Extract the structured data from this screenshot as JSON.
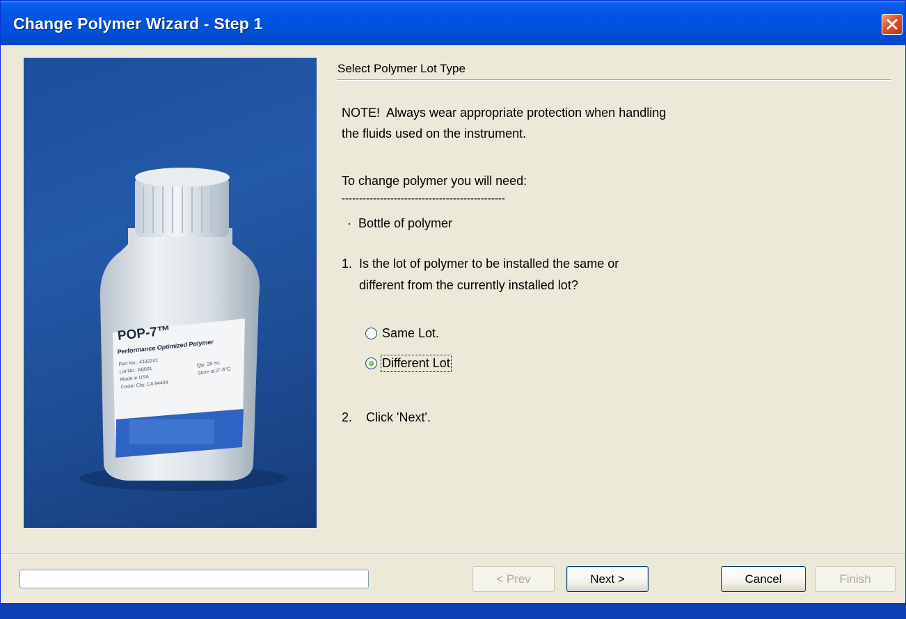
{
  "window": {
    "title": "Change Polymer Wizard - Step 1"
  },
  "photo": {
    "label_brand": "POP-7™",
    "label_subtitle": "Performance Optimized Polymer",
    "label_lines": [
      "Part No.: 4332241",
      "Lot No.: AB001",
      "Made in USA",
      "Foster City, CA 94404"
    ],
    "label_side": [
      "Qty: 28 mL",
      "Store at 2°-8°C"
    ]
  },
  "content": {
    "section_title": "Select Polymer Lot Type",
    "note_line1": "NOTE!  Always wear appropriate protection when handling",
    "note_line2": "the fluids used on the instrument.",
    "need_heading": "To change polymer you will need:",
    "dashes": "-----------------------------------------------",
    "bullet_item": " ·  Bottle of polymer",
    "question_line1": "1.  Is the lot of polymer to be installed the same or",
    "question_line2": "     different from the currently installed lot?",
    "step2": "2.    Click 'Next'."
  },
  "options": {
    "same_lot": {
      "label": "Same Lot.",
      "checked": false
    },
    "different_lot": {
      "label": "Different Lot",
      "checked": true
    }
  },
  "buttons": {
    "prev": "< Prev",
    "next": "Next >",
    "cancel": "Cancel",
    "finish": "Finish"
  },
  "colors": {
    "titlebar": "#0054e3",
    "window_bg": "#ece9d8",
    "close_button": "#e0502a",
    "radio_selected": "#4fb820"
  }
}
